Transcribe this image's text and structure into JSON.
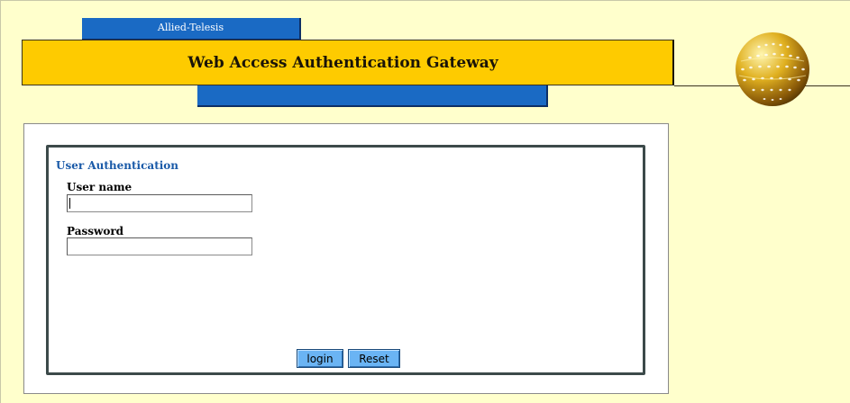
{
  "header": {
    "brand": "Allied-Telesis",
    "title": "Web Access Authentication Gateway",
    "logo_icon": "globe-icon"
  },
  "auth": {
    "section_title": "User Authentication",
    "username_label": "User name",
    "username_value": "",
    "password_label": "Password",
    "password_value": "",
    "login_label": "login",
    "reset_label": "Reset"
  },
  "colors": {
    "background": "#ffffcc",
    "banner": "#fecb00",
    "accent_blue": "#1a6ac4",
    "button": "#6ab4f4",
    "section_title": "#1a5aa8"
  }
}
